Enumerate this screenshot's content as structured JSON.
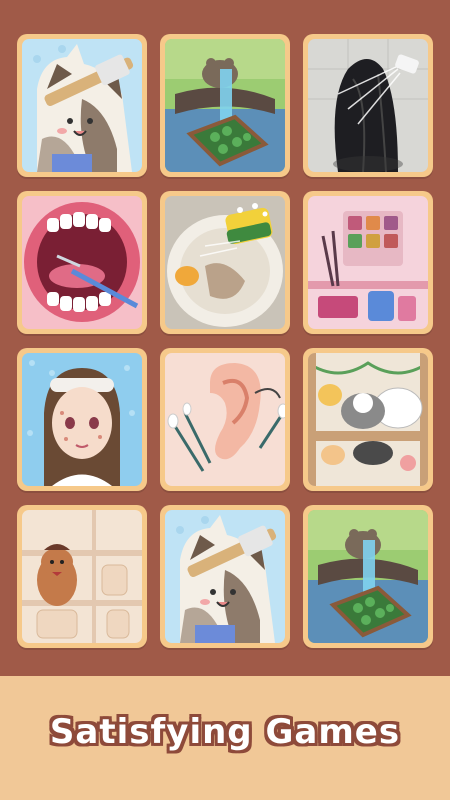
{
  "caption": "Satisfying Games",
  "colors": {
    "background": "#a05a48",
    "tile_border": "#f6c98a",
    "footer": "#f1c897",
    "caption_outline": "#8e4a3a"
  },
  "tiles": [
    {
      "id": "dog-cleaning",
      "icon": "dirty-dog-icon"
    },
    {
      "id": "frog-pond",
      "icon": "frog-fountain-icon"
    },
    {
      "id": "hair-wash",
      "icon": "hair-shower-icon"
    },
    {
      "id": "teeth-cleaning",
      "icon": "teeth-dentist-icon"
    },
    {
      "id": "plate-washing",
      "icon": "plate-sponge-icon"
    },
    {
      "id": "makeup-organizer",
      "icon": "makeup-shelf-icon"
    },
    {
      "id": "face-care",
      "icon": "girl-face-icon"
    },
    {
      "id": "ear-cleaning",
      "icon": "ear-cotton-swab-icon"
    },
    {
      "id": "pet-shelf",
      "icon": "cats-dogs-shelf-icon"
    },
    {
      "id": "capybara-shelf",
      "icon": "capybara-shelf-icon"
    },
    {
      "id": "dog-cleaning-2",
      "icon": "dirty-dog-icon"
    },
    {
      "id": "frog-pond-2",
      "icon": "frog-fountain-icon"
    }
  ]
}
